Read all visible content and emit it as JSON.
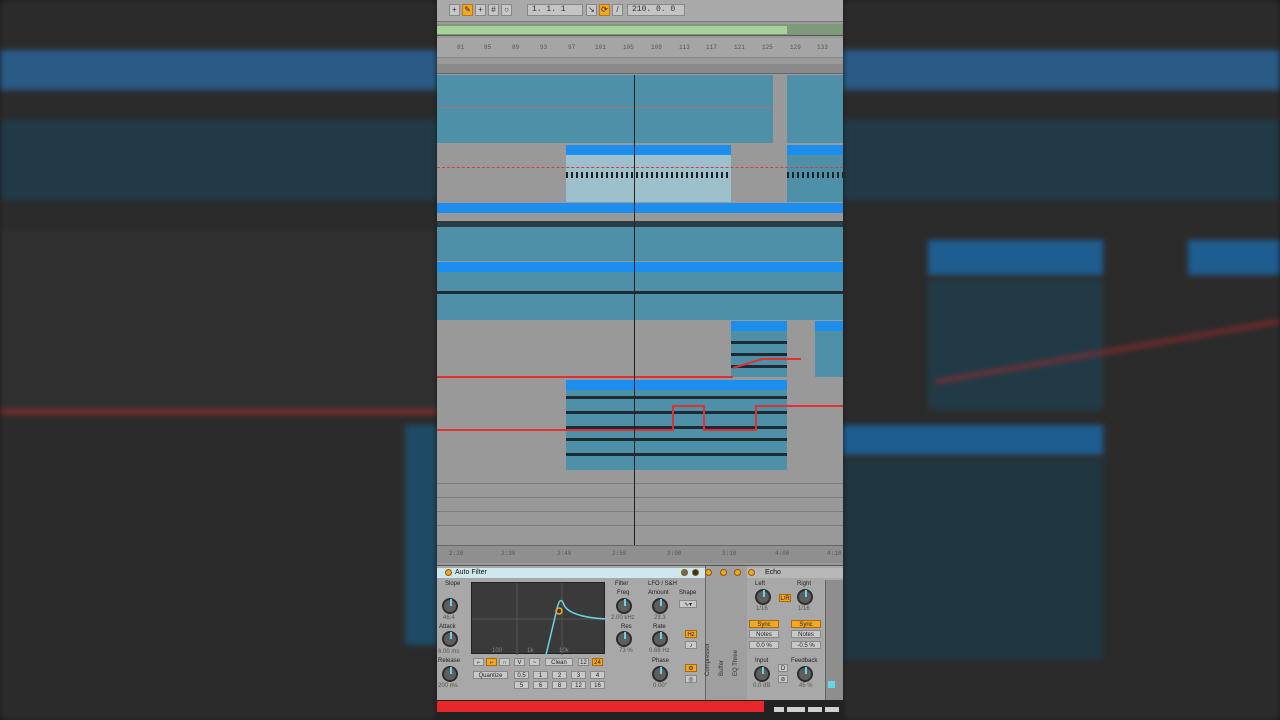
{
  "toolbar": {
    "position": "1.   1.   1",
    "end_value": "210.   0.   0"
  },
  "ruler": {
    "ticks": [
      "81",
      "85",
      "89",
      "93",
      "97",
      "101",
      "105",
      "109",
      "113",
      "117",
      "121",
      "125",
      "129",
      "133",
      "137"
    ]
  },
  "bottom_ruler": {
    "ticks": [
      "2:20",
      "2:30",
      "2:40",
      "2:50",
      "3:00",
      "3:10",
      "3:20",
      "3:30",
      "3:40",
      "4:00",
      "4:10"
    ]
  },
  "auto_filter": {
    "title": "Auto Filter",
    "slope_label": "Slope",
    "slope_value": "46.4",
    "attack_label": "Attack",
    "attack_value": "6.00 ms",
    "release_label": "Release",
    "release_value": "200 ms",
    "filter_label": "Filter",
    "freq_label": "Freq",
    "freq_value": "2.00 kHz",
    "res_label": "Res",
    "res_value": "73 %",
    "lfo_label": "LFO / S&H",
    "amount_label": "Amount",
    "amount_value": "23.3",
    "shape_label": "Shape",
    "rate_label": "Rate",
    "rate_value": "0.68 Hz",
    "phase_label": "Phase",
    "phase_value": "0.00°",
    "mode_value": "Clean",
    "slope_12": "12",
    "slope_24": "24",
    "quantize_label": "Quantize",
    "quantize_values": [
      "0.5",
      "1",
      "2",
      "3",
      "4",
      "5",
      "6",
      "8",
      "12",
      "16"
    ],
    "axis_labels": [
      "100",
      "1k",
      "10k"
    ],
    "hz_label": "Hz"
  },
  "side_labels": {
    "compressor": "Compressor",
    "buffer": "Buffer",
    "eq_three": "EQ Three"
  },
  "echo": {
    "title": "Echo",
    "left_label": "Left",
    "left_value": "1/16",
    "right_label": "Right",
    "right_value": "1/16",
    "link_label": "L/R",
    "sync_left": "Sync",
    "sync_right": "Sync",
    "mode_left": "Notes",
    "mode_right": "Notes",
    "offset_left": "0.0 %",
    "offset_right": "-0.5 %",
    "input_label": "Input",
    "input_value": "0.0 dB",
    "feedback_label": "Feedback",
    "feedback_value": "45 %"
  },
  "colors": {
    "clip": "#4d90a8",
    "clip_header": "#1b8ef0",
    "automation": "#e03030",
    "accent": "#f5a623"
  }
}
